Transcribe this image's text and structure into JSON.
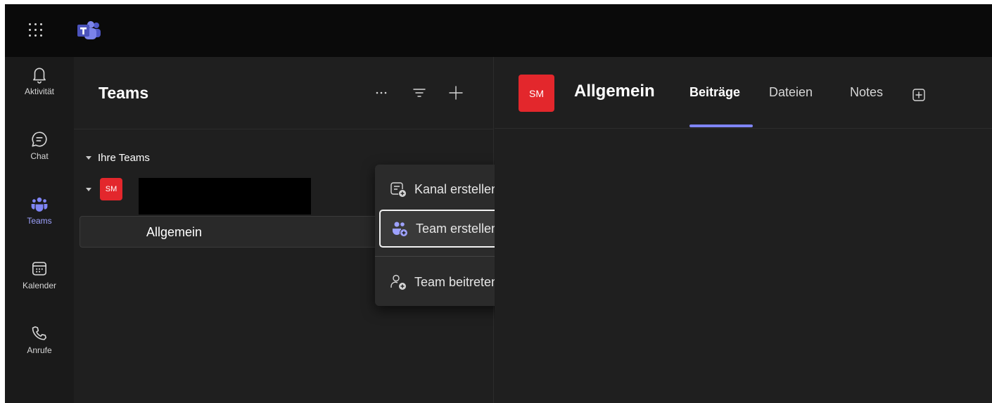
{
  "app": {
    "title": "Microsoft Teams"
  },
  "icons": {
    "waffle": "app-launcher-icon",
    "logo": "teams-logo-icon",
    "activity": "bell-icon",
    "chat": "chat-icon",
    "teams": "teams-icon",
    "calendar": "calendar-icon",
    "calls": "phone-icon"
  },
  "colors": {
    "accent": "#7f85f5",
    "teams_active": "#9ea2ff",
    "avatar": "#e3272c"
  },
  "rail": {
    "items": [
      {
        "label": "Aktivität",
        "active": false
      },
      {
        "label": "Chat",
        "active": false
      },
      {
        "label": "Teams",
        "active": true
      },
      {
        "label": "Kalender",
        "active": false
      },
      {
        "label": "Anrufe",
        "active": false
      }
    ]
  },
  "teams_pane": {
    "title": "Teams",
    "section_label": "Ihre Teams",
    "team": {
      "avatar_initials": "SM"
    },
    "channel": {
      "label": "Allgemein"
    }
  },
  "menu": {
    "items": [
      {
        "label": "Kanal erstellen"
      },
      {
        "label": "Team erstellen",
        "focused": true
      },
      {
        "label": "Team beitreten"
      }
    ]
  },
  "channel_view": {
    "avatar_initials": "SM",
    "title": "Allgemein",
    "tabs": [
      {
        "label": "Beiträge",
        "active": true
      },
      {
        "label": "Dateien",
        "active": false
      },
      {
        "label": "Notes",
        "active": false
      }
    ]
  }
}
